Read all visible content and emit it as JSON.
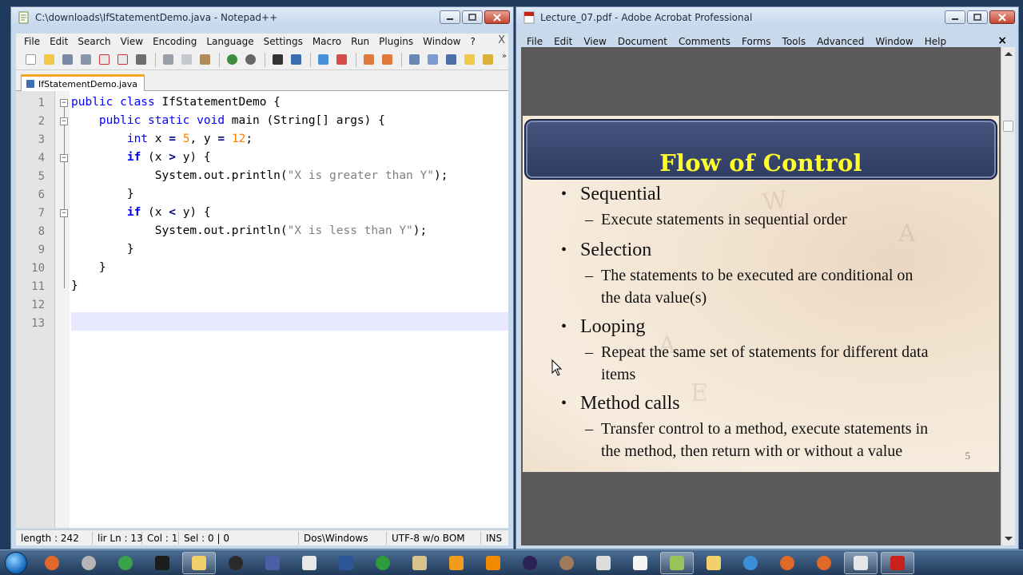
{
  "colors": {
    "npp_keyword": "#0000ff",
    "npp_number": "#ff8000",
    "npp_string": "#808080",
    "slide_title": "#ffff2e",
    "slide_banner": "#3a4870",
    "acrobat_red": "#c8201a"
  },
  "npp": {
    "title": "C:\\downloads\\IfStatementDemo.java - Notepad++",
    "menu": [
      "File",
      "Edit",
      "Search",
      "View",
      "Encoding",
      "Language",
      "Settings",
      "Macro",
      "Run",
      "Plugins",
      "Window",
      "?"
    ],
    "menu_close": "X",
    "toolbar_more": "»",
    "tab_label": "IfStatementDemo.java",
    "lines": [
      {
        "n": "1"
      },
      {
        "n": "2"
      },
      {
        "n": "3"
      },
      {
        "n": "4"
      },
      {
        "n": "5"
      },
      {
        "n": "6"
      },
      {
        "n": "7"
      },
      {
        "n": "8"
      },
      {
        "n": "9"
      },
      {
        "n": "10"
      },
      {
        "n": "11"
      },
      {
        "n": "12"
      },
      {
        "n": "13"
      }
    ],
    "code": {
      "l1_kw": "public class",
      "l1_rest": " IfStatementDemo {",
      "l2_kw": "public static void",
      "l2_rest": " main (String[] args) {",
      "l3_kw": "int",
      "l3_a": " x ",
      "l3_eq1": "=",
      "l3_num1": " 5",
      "l3_b": ", y ",
      "l3_eq2": "=",
      "l3_num2": " 12",
      "l3_c": ";",
      "l4_kw": "if",
      "l4_a": " (x ",
      "l4_op": ">",
      "l4_b": " y) {",
      "l5_a": "System.out.println(",
      "l5_str": "\"X is greater than Y\"",
      "l5_b": ");",
      "l6": "}",
      "l7_kw": "if",
      "l7_a": " (x ",
      "l7_op": "<",
      "l7_b": " y) {",
      "l8_a": "System.out.println(",
      "l8_str": "\"X is less than Y\"",
      "l8_b": ");",
      "l9": "}",
      "l10": "}",
      "l11": "}"
    },
    "status": {
      "length": "length : 242",
      "lines_pos": "lir Ln : 13",
      "col": "Col : 1",
      "sel": "Sel : 0 | 0",
      "eol": "Dos\\Windows",
      "encoding": "UTF-8 w/o BOM",
      "mode": "INS"
    }
  },
  "acrobat": {
    "title": "Lecture_07.pdf - Adobe Acrobat Professional",
    "menu": [
      "File",
      "Edit",
      "View",
      "Document",
      "Comments",
      "Forms",
      "Tools",
      "Advanced",
      "Window",
      "Help"
    ],
    "menu_close": "×",
    "slide": {
      "title": "Flow of Control",
      "items": [
        {
          "head": "Sequential",
          "sub": [
            "Execute statements in sequential order"
          ]
        },
        {
          "head": "Selection",
          "sub": [
            "The statements to be executed are conditional on",
            "the data value(s)"
          ]
        },
        {
          "head": "Looping",
          "sub": [
            "Repeat the same set of statements for different data",
            "items"
          ]
        },
        {
          "head": "Method calls",
          "sub": [
            "Transfer control to a method, execute statements in",
            "the method, then return with or without a value"
          ]
        }
      ],
      "page_number": "5"
    }
  },
  "taskbar": {
    "items": [
      "firefox-icon",
      "maps-icon",
      "chrome-icon",
      "network-icon",
      "folder-icon",
      "lock-icon",
      "notepad-icon",
      "window-icon",
      "word-icon",
      "sync-icon",
      "java-icon",
      "media-player-icon",
      "vlc-icon",
      "eclipse-icon",
      "globe-icon",
      "package-icon",
      "tex-icon",
      "notepadpp-icon",
      "explorer-icon",
      "chrome-icon-2",
      "firefox-icon-2",
      "firefox-icon-3",
      "virtualbox-icon",
      "acrobat-icon"
    ]
  }
}
